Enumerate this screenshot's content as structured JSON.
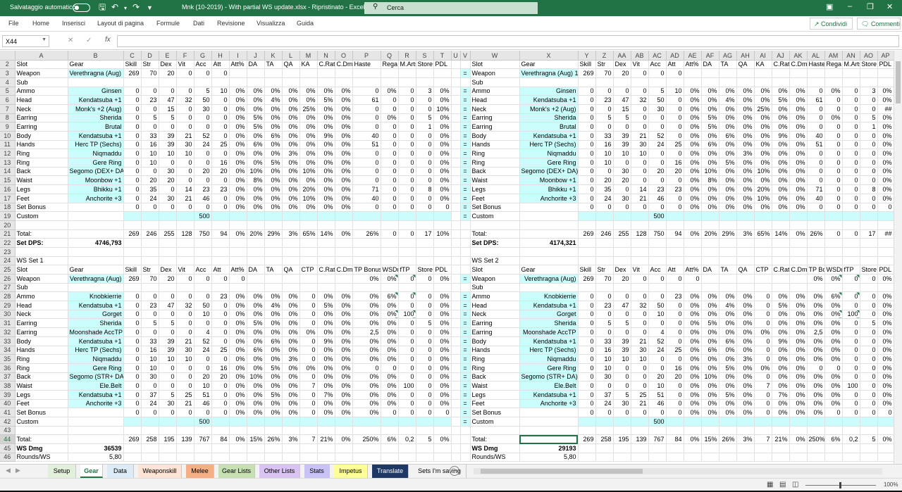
{
  "titlebar": {
    "autosave": "Salvataggio automatico",
    "doc_title": "Mnk (10-2019) - With partial WS update.xlsx  -  Ripristinato  -  Excel",
    "search_placeholder": "Cerca"
  },
  "menu": [
    "File",
    "Home",
    "Inserisci",
    "Layout di pagina",
    "Formule",
    "Dati",
    "Revisione",
    "Visualizza",
    "Guida"
  ],
  "share_label": "Condividi",
  "comments_label": "Commenti",
  "name_box": "X44",
  "formula_text": "",
  "colors": {
    "accent": "#217346",
    "cyan_fill": "#ccfdfd"
  },
  "columns": [
    "A",
    "B",
    "C",
    "D",
    "E",
    "F",
    "G",
    "H",
    "I",
    "J",
    "K",
    "L",
    "M",
    "N",
    "O",
    "P",
    "Q",
    "R",
    "S",
    "T",
    "U",
    "V",
    "W",
    "X",
    "Y",
    "Z",
    "AA",
    "AB",
    "AC",
    "AD",
    "AE",
    "AF",
    "AG",
    "AH",
    "AI",
    "AJ",
    "AK",
    "AL",
    "AM",
    "AN",
    "AO",
    "AP"
  ],
  "rows": [
    {
      "n": "2",
      "l": [
        "Slot",
        "Gear",
        "Skill",
        "Str",
        "Dex",
        "Vit",
        "Acc",
        "Att",
        "Att%",
        "DA",
        "TA",
        "QA",
        "KA",
        "C.Rat",
        "C.Dmg",
        "Haste",
        "Rega",
        "M.Arts",
        "Store",
        "PDL"
      ]
    },
    {
      "n": "3",
      "l": [
        "Weapon",
        "Verethragna (Aug) 1:",
        "269",
        "70",
        "20",
        "0",
        "0",
        "0",
        "",
        "",
        "",
        "",
        "",
        "",
        "",
        "",
        "",
        "",
        "",
        ""
      ],
      "eq": "="
    },
    {
      "n": "4",
      "l": [
        "Sub",
        "",
        "",
        "",
        "",
        "",
        "",
        "",
        "",
        "",
        "",
        "",
        "",
        "",
        "",
        "",
        "",
        "",
        "",
        ""
      ]
    },
    {
      "n": "5",
      "l": [
        "Ammo",
        "Ginsen",
        "0",
        "0",
        "0",
        "0",
        "5",
        "10",
        "0%",
        "0%",
        "0%",
        "0%",
        "0%",
        "0%",
        "0%",
        "0",
        "0%",
        "0",
        "3",
        "0%"
      ],
      "eq": "="
    },
    {
      "n": "6",
      "l": [
        "Head",
        "Kendatsuba +1",
        "0",
        "23",
        "47",
        "32",
        "50",
        "0",
        "0%",
        "0%",
        "4%",
        "0%",
        "0%",
        "5%",
        "0%",
        "61",
        "0",
        "0",
        "0",
        "0%"
      ],
      "eq": "="
    },
    {
      "n": "7",
      "l": [
        "Neck",
        "Monk's +2 (Aug)",
        "0",
        "0",
        "15",
        "0",
        "30",
        "0",
        "0%",
        "0%",
        "0%",
        "0%",
        "25%",
        "0%",
        "0%",
        "0",
        "0",
        "0",
        "0",
        "10%"
      ],
      "eq": "="
    },
    {
      "n": "8",
      "l": [
        "Earring",
        "Sherida",
        "0",
        "5",
        "5",
        "0",
        "0",
        "0",
        "0%",
        "5%",
        "0%",
        "0%",
        "0%",
        "0%",
        "0%",
        "0",
        "0%",
        "0",
        "5",
        "0%"
      ],
      "eq": "="
    },
    {
      "n": "9",
      "l": [
        "Earring",
        "Brutal",
        "0",
        "0",
        "0",
        "0",
        "0",
        "0",
        "0%",
        "5%",
        "0%",
        "0%",
        "0%",
        "0%",
        "0%",
        "0",
        "0",
        "0",
        "1",
        "0%"
      ],
      "eq": "="
    },
    {
      "n": "10",
      "l": [
        "Body",
        "Kendatsuba +1",
        "0",
        "33",
        "39",
        "21",
        "52",
        "0",
        "0%",
        "0%",
        "6%",
        "0%",
        "0%",
        "9%",
        "0%",
        "40",
        "0",
        "0",
        "0",
        "0%"
      ],
      "eq": "="
    },
    {
      "n": "11",
      "l": [
        "Hands",
        "Herc TP (Sechs)",
        "0",
        "16",
        "39",
        "30",
        "24",
        "25",
        "0%",
        "6%",
        "0%",
        "0%",
        "0%",
        "0%",
        "0%",
        "51",
        "0",
        "0",
        "0",
        "0%"
      ],
      "eq": "="
    },
    {
      "n": "12",
      "l": [
        "Ring",
        "Niqmaddu",
        "0",
        "10",
        "10",
        "10",
        "0",
        "0",
        "0%",
        "0%",
        "0%",
        "3%",
        "0%",
        "0%",
        "0%",
        "0",
        "0",
        "0",
        "0",
        "0%"
      ],
      "eq": "="
    },
    {
      "n": "13",
      "l": [
        "Ring",
        "Gere Ring",
        "0",
        "10",
        "0",
        "0",
        "0",
        "16",
        "0%",
        "0%",
        "5%",
        "0%",
        "0%",
        "0%",
        "0%",
        "0",
        "0",
        "0",
        "0",
        "0%"
      ],
      "eq": "="
    },
    {
      "n": "14",
      "l": [
        "Back",
        "Segomo (DEX+ DA)",
        "0",
        "0",
        "30",
        "0",
        "20",
        "20",
        "0%",
        "10%",
        "0%",
        "0%",
        "10%",
        "0%",
        "0%",
        "0",
        "0",
        "0",
        "0",
        "0%"
      ],
      "eq": "="
    },
    {
      "n": "15",
      "l": [
        "Waist",
        "Moonbow +1",
        "0",
        "20",
        "20",
        "0",
        "0",
        "0",
        "0%",
        "8%",
        "0%",
        "0%",
        "0%",
        "0%",
        "0%",
        "0",
        "0",
        "0",
        "0",
        "0%"
      ],
      "eq": "="
    },
    {
      "n": "16",
      "l": [
        "Legs",
        "Bhikku +1",
        "0",
        "35",
        "0",
        "14",
        "23",
        "23",
        "0%",
        "0%",
        "0%",
        "0%",
        "20%",
        "0%",
        "0%",
        "71",
        "0",
        "0",
        "8",
        "0%"
      ],
      "eq": "="
    },
    {
      "n": "17",
      "l": [
        "Feet",
        "Anchorite +3",
        "0",
        "24",
        "30",
        "21",
        "46",
        "0",
        "0%",
        "0%",
        "0%",
        "0%",
        "10%",
        "0%",
        "0%",
        "40",
        "0",
        "0",
        "0",
        "0%"
      ],
      "eq": "="
    },
    {
      "n": "18",
      "l": [
        "Set Bonus",
        "",
        "0",
        "0",
        "0",
        "0",
        "0",
        "0",
        "0%",
        "0%",
        "0%",
        "0%",
        "0%",
        "0%",
        "0%",
        "0",
        "0",
        "0",
        "0",
        "0"
      ],
      "eq": "="
    },
    {
      "n": "19",
      "l": [
        "Custom",
        "",
        "",
        "",
        "",
        "",
        "500",
        "",
        "",
        "",
        "",
        "",
        "",
        "",
        "",
        "",
        "",
        "",
        "",
        ""
      ],
      "eq": "="
    },
    {
      "n": "20",
      "l": [
        "",
        "",
        "",
        "",
        "",
        "",
        "",
        "",
        "",
        "",
        "",
        "",
        "",
        "",
        "",
        "",
        "",
        "",
        "",
        ""
      ]
    },
    {
      "n": "21",
      "l": [
        "Total:",
        "",
        "269",
        "246",
        "255",
        "128",
        "750",
        "94",
        "0%",
        "20%",
        "29%",
        "3%",
        "65%",
        "14%",
        "0%",
        "26%",
        "0",
        "0",
        "17",
        "10%"
      ]
    },
    {
      "n": "22",
      "l": [
        "Set DPS:",
        "4746,793",
        "",
        "",
        "",
        "",
        "",
        "",
        "",
        "",
        "",
        "",
        "",
        "",
        "",
        "",
        "",
        "",
        "",
        ""
      ]
    },
    {
      "n": "23",
      "l": [
        "",
        "",
        "",
        "",
        "",
        "",
        "",
        "",
        "",
        "",
        "",
        "",
        "",
        "",
        "",
        "",
        "",
        "",
        "",
        ""
      ]
    },
    {
      "n": "24",
      "l": [
        "WS Set 1",
        "",
        "",
        "",
        "",
        "",
        "",
        "",
        "",
        "",
        "",
        "",
        "",
        "",
        "",
        "",
        "",
        "",
        "",
        ""
      ]
    },
    {
      "n": "25",
      "l": [
        "Slot",
        "Gear",
        "Skill",
        "Str",
        "Dex",
        "Vit",
        "Acc",
        "Att",
        "Att%",
        "DA",
        "TA",
        "QA",
        "CTP",
        "C.Rat",
        "C.Dmg",
        "TP Bonus",
        "WSDmg",
        "fTP",
        "Store",
        "PDL"
      ]
    },
    {
      "n": "26",
      "l": [
        "Weapon",
        "Verethragna (Aug)",
        "269",
        "70",
        "20",
        "0",
        "0",
        "0",
        "0",
        "",
        "",
        "",
        "",
        "",
        "",
        "0%",
        "0%",
        "0",
        "0",
        "0%"
      ],
      "eq": "="
    },
    {
      "n": "27",
      "l": [
        "Sub",
        "",
        "",
        "",
        "",
        "",
        "",
        "",
        "",
        "",
        "",
        "",
        "",
        "",
        "",
        "",
        "",
        "",
        "",
        ""
      ]
    },
    {
      "n": "28",
      "l": [
        "Ammo",
        "Knobkierrie",
        "0",
        "0",
        "0",
        "0",
        "0",
        "23",
        "0%",
        "0%",
        "0%",
        "0%",
        "0",
        "0%",
        "0%",
        "0%",
        "6%",
        "0",
        "0",
        "0%"
      ],
      "eq": "="
    },
    {
      "n": "29",
      "l": [
        "Head",
        "Kendatsuba +1",
        "0",
        "23",
        "47",
        "32",
        "50",
        "0",
        "0%",
        "0%",
        "4%",
        "0%",
        "0",
        "5%",
        "0%",
        "0%",
        "0%",
        "0",
        "0",
        "0%"
      ],
      "eq": "="
    },
    {
      "n": "30",
      "l": [
        "Neck",
        "Gorget",
        "0",
        "0",
        "0",
        "0",
        "10",
        "0",
        "0%",
        "0%",
        "0%",
        "0%",
        "0",
        "0%",
        "0%",
        "0%",
        "0%",
        "100",
        "0",
        "0%"
      ],
      "eq": "="
    },
    {
      "n": "31",
      "l": [
        "Earring",
        "Sherida",
        "0",
        "5",
        "5",
        "0",
        "0",
        "0",
        "0%",
        "5%",
        "0%",
        "0%",
        "0",
        "0%",
        "0%",
        "0%",
        "0%",
        "0",
        "5",
        "0%"
      ],
      "eq": "="
    },
    {
      "n": "32",
      "l": [
        "Earring",
        "Moonshade AccTP",
        "0",
        "0",
        "0",
        "0",
        "4",
        "0",
        "0%",
        "0%",
        "0%",
        "0%",
        "0%",
        "0%",
        "0%",
        "2,5",
        "0%",
        "0",
        "0",
        "0%"
      ],
      "eq": "="
    },
    {
      "n": "33",
      "l": [
        "Body",
        "Kendatsuba +1",
        "0",
        "33",
        "39",
        "21",
        "52",
        "0",
        "0%",
        "0%",
        "6%",
        "0%",
        "0",
        "9%",
        "0%",
        "0%",
        "0%",
        "0",
        "0",
        "0%"
      ],
      "eq": "="
    },
    {
      "n": "34",
      "l": [
        "Hands",
        "Herc TP (Sechs)",
        "0",
        "16",
        "39",
        "30",
        "24",
        "25",
        "0%",
        "6%",
        "0%",
        "0%",
        "0",
        "0%",
        "0%",
        "0%",
        "0%",
        "0",
        "0",
        "0%"
      ],
      "eq": "="
    },
    {
      "n": "35",
      "l": [
        "Ring",
        "Niqmaddu",
        "0",
        "10",
        "10",
        "10",
        "0",
        "0",
        "0%",
        "0%",
        "0%",
        "3%",
        "0",
        "0%",
        "0%",
        "0%",
        "0%",
        "0",
        "0",
        "0%"
      ],
      "eq": "="
    },
    {
      "n": "36",
      "l": [
        "Ring",
        "Gere Ring",
        "0",
        "10",
        "0",
        "0",
        "0",
        "16",
        "0%",
        "0%",
        "5%",
        "0%",
        "0%",
        "0%",
        "0%",
        "0",
        "0",
        "0",
        "0",
        "0%"
      ],
      "eq": "="
    },
    {
      "n": "37",
      "l": [
        "Back",
        "Segomo (STR+ DA)",
        "0",
        "30",
        "0",
        "0",
        "20",
        "20",
        "0%",
        "10%",
        "0%",
        "0%",
        "0",
        "0%",
        "0%",
        "0%",
        "0%",
        "0",
        "0",
        "0%"
      ],
      "eq": "="
    },
    {
      "n": "38",
      "l": [
        "Waist",
        "Ele.Belt",
        "0",
        "0",
        "0",
        "0",
        "10",
        "0",
        "0%",
        "0%",
        "0%",
        "0%",
        "7",
        "0%",
        "0%",
        "0%",
        "0%",
        "100",
        "0",
        "0%"
      ],
      "eq": "="
    },
    {
      "n": "39",
      "l": [
        "Legs",
        "Kendatsuba +1",
        "0",
        "37",
        "5",
        "25",
        "51",
        "0",
        "0%",
        "0%",
        "5%",
        "0%",
        "0",
        "7%",
        "0%",
        "0%",
        "0%",
        "0",
        "0",
        "0%"
      ],
      "eq": "="
    },
    {
      "n": "40",
      "l": [
        "Feet",
        "Anchorite +3",
        "0",
        "24",
        "30",
        "21",
        "46",
        "0",
        "0%",
        "0%",
        "0%",
        "0%",
        "0",
        "0%",
        "0%",
        "0%",
        "0%",
        "0",
        "0",
        "0%"
      ],
      "eq": "="
    },
    {
      "n": "41",
      "l": [
        "Set Bonus",
        "",
        "0",
        "0",
        "0",
        "0",
        "0",
        "0",
        "0%",
        "0%",
        "0%",
        "0%",
        "0",
        "0%",
        "0%",
        "0%",
        "0",
        "0",
        "0",
        "0"
      ],
      "eq": "="
    },
    {
      "n": "42",
      "l": [
        "Custom",
        "",
        "",
        "",
        "",
        "",
        "500",
        "",
        "",
        "",
        "",
        "",
        "",
        "",
        "",
        "",
        "",
        "",
        "",
        ""
      ],
      "eq": "="
    },
    {
      "n": "43",
      "l": [
        "",
        "",
        "",
        "",
        "",
        "",
        "",
        "",
        "",
        "",
        "",
        "",
        "",
        "",
        "",
        "",
        "",
        "",
        "",
        ""
      ]
    },
    {
      "n": "44",
      "l": [
        "Total:",
        "",
        "269",
        "258",
        "195",
        "139",
        "767",
        "84",
        "0%",
        "15%",
        "26%",
        "3%",
        "7",
        "21%",
        "0%",
        "250%",
        "6%",
        "0,2",
        "5",
        "0%"
      ]
    },
    {
      "n": "45",
      "l": [
        "WS Dmg",
        "36539",
        "",
        "",
        "",
        "",
        "",
        "",
        "",
        "",
        "",
        "",
        "",
        "",
        "",
        "",
        "",
        "",
        "",
        ""
      ]
    },
    {
      "n": "46",
      "l": [
        "Rounds/WS",
        "5,80",
        "",
        "",
        "",
        "",
        "",
        "",
        "",
        "",
        "",
        "",
        "",
        "",
        "",
        "",
        "",
        "",
        "",
        ""
      ]
    }
  ],
  "right_overrides": {
    "3": {
      "0": "Weapon",
      "1": "Verethragna (Aug) 1:"
    },
    "7": {
      "19": "##"
    },
    "21": {
      "17": "0",
      "18": "17",
      "19": "##"
    },
    "22": {
      "1": "4174,321"
    },
    "24": {
      "0": "WS Set 2"
    },
    "26": {
      "1": "Verethragna (Aug)"
    },
    "44": {},
    "45": {
      "1": "29193"
    }
  },
  "sheets": [
    {
      "name": "Setup",
      "bg": "#e2efda",
      "fg": "#000",
      "w": 40
    },
    {
      "name": "Gear",
      "bg": "#ffffff",
      "fg": "#217346",
      "w": 32,
      "active": true
    },
    {
      "name": "Data",
      "bg": "#ddebf7",
      "fg": "#000",
      "w": 38
    },
    {
      "name": "Weaponskill",
      "bg": "#fce4d6",
      "fg": "#000",
      "w": 62
    },
    {
      "name": "Melee",
      "bg": "#f4b084",
      "fg": "#000",
      "w": 40
    },
    {
      "name": "Gear Lists",
      "bg": "#c6e0b4",
      "fg": "#000",
      "w": 52
    },
    {
      "name": "Other Lists",
      "bg": "#d9c3f0",
      "fg": "#000",
      "w": 58
    },
    {
      "name": "Stats",
      "bg": "#c9c3f5",
      "fg": "#000",
      "w": 36
    },
    {
      "name": "Impetus",
      "bg": "#ffff99",
      "fg": "#000",
      "w": 48
    },
    {
      "name": "Translate",
      "bg": "#203864",
      "fg": "#fff",
      "w": 52
    },
    {
      "name": "Sets I'm saving",
      "bg": "#f2f2f2",
      "fg": "#000",
      "w": 76
    }
  ],
  "zoom": "100%"
}
